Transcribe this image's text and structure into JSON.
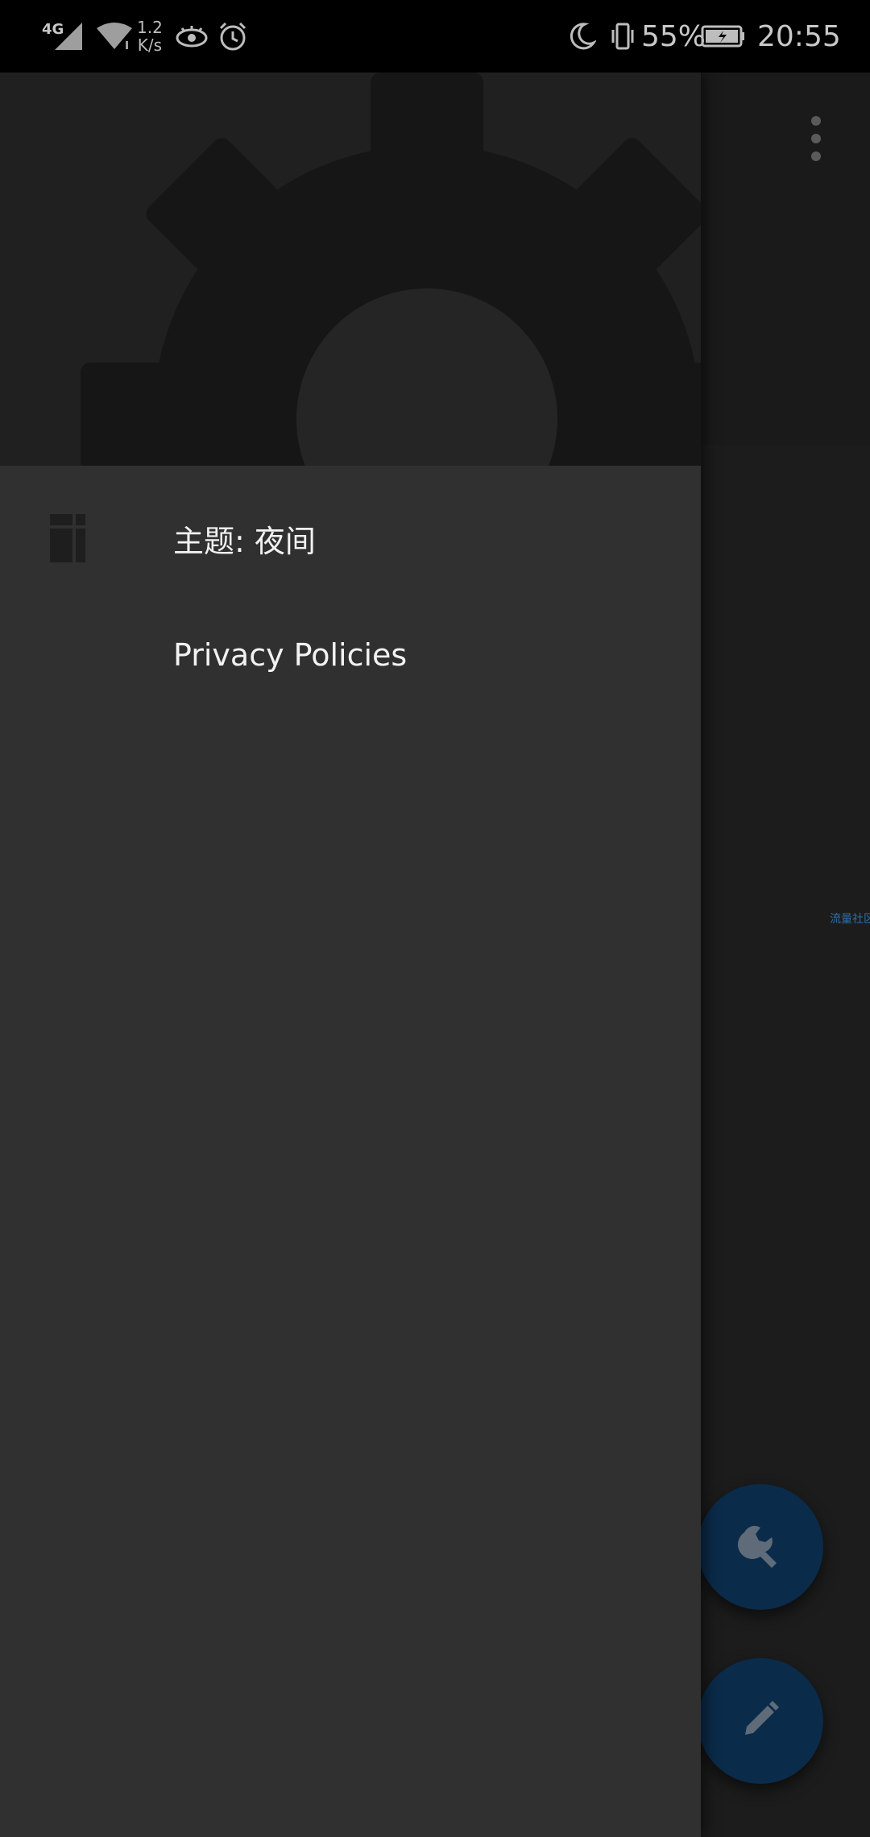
{
  "status_bar": {
    "network_type": "4G",
    "net_speed_value": "1.2",
    "net_speed_unit": "K/s",
    "battery_percent": "55%",
    "time": "20:55",
    "icons": [
      "signal-icon",
      "wifi-icon",
      "eye-icon",
      "alarm-icon",
      "moon-icon",
      "vibrate-icon",
      "battery-charging-icon"
    ]
  },
  "drawer": {
    "header_icon": "gear-icon",
    "items": [
      {
        "label": "主题: 夜间",
        "icon": "theme-icon"
      },
      {
        "label": "Privacy Policies",
        "icon": ""
      }
    ]
  },
  "app": {
    "side_link": "流量社区",
    "fabs": [
      {
        "name": "tools",
        "icon": "wrench-icon"
      },
      {
        "name": "edit",
        "icon": "pencil-icon"
      }
    ],
    "menu_icon": "more-vert-icon"
  },
  "colors": {
    "drawer_bg": "#303030",
    "drawer_header_bg": "#202020",
    "fab_bg": "#0b2b4a",
    "link": "#2f6fa8"
  }
}
